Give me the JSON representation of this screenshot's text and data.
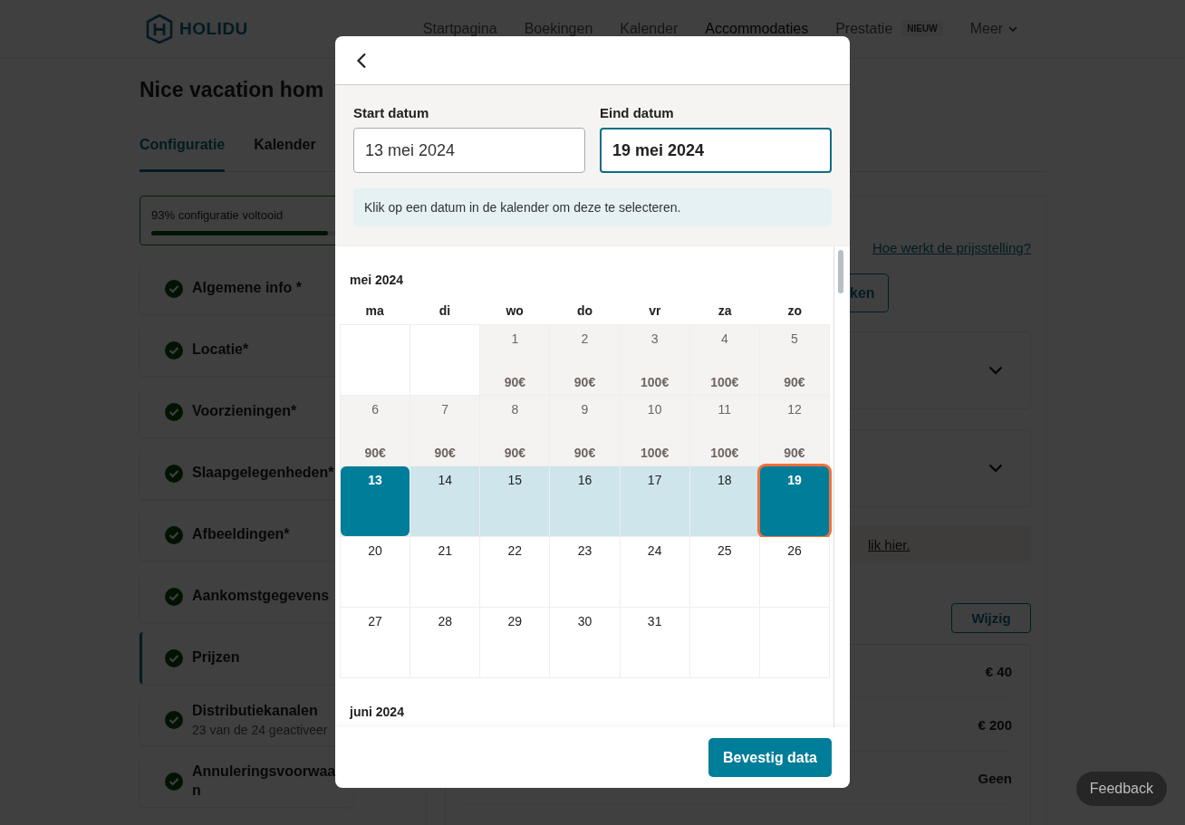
{
  "header": {
    "logo": "HOLIDU",
    "nav": [
      {
        "label": "Startpagina",
        "selected": false
      },
      {
        "label": "Boekingen",
        "selected": false
      },
      {
        "label": "Kalender",
        "selected": false
      },
      {
        "label": "Accommodaties",
        "selected": true
      },
      {
        "label": "Prestatie",
        "selected": false,
        "badge": "NIEUW"
      },
      {
        "label": "Meer",
        "selected": false,
        "dropdown": true
      }
    ]
  },
  "page": {
    "title": "Nice vacation hom",
    "tabs": [
      {
        "label": "Configuratie",
        "selected": true
      },
      {
        "label": "Kalender",
        "selected": false
      }
    ]
  },
  "progress": {
    "label": "93% configuratie voltooid",
    "level": 0.93
  },
  "sidebar": {
    "items": [
      {
        "label": "Algemene info *",
        "done": true,
        "selected": false
      },
      {
        "label": "Locatie*",
        "done": true,
        "selected": false
      },
      {
        "label": "Voorzieningen*",
        "done": true,
        "selected": false
      },
      {
        "label": "Slaapgelegenheden*",
        "done": true,
        "selected": false
      },
      {
        "label": "Afbeeldingen*",
        "done": true,
        "selected": false
      },
      {
        "label": "Aankomstgegevens",
        "done": true,
        "selected": false
      },
      {
        "label": "Prijzen",
        "done": true,
        "selected": true
      },
      {
        "label": "Distributiekanalen",
        "subtitle": "23 van de 24 geactiveer",
        "done": true,
        "selected": false
      },
      {
        "label": "Annuleringsvoorwaa\nn",
        "done": true,
        "selected": false
      }
    ]
  },
  "pricing": {
    "help_link": "Hoe werkt de prijsstelling?",
    "action_button": "ken",
    "panels": [
      {
        "expanded": false
      },
      {
        "expanded": false
      }
    ],
    "notice_link": "lik hier.",
    "edit_button": "Wijzig",
    "fees": [
      "€ 40",
      "€ 200",
      "Geen"
    ]
  },
  "modal": {
    "start": {
      "label": "Start datum",
      "value": "13 mei 2024",
      "focused": false
    },
    "end": {
      "label": "Eind datum",
      "value": "19 mei 2024",
      "focused": true
    },
    "hint": "Klik op een datum in de kalender om deze te selecteren.",
    "months": [
      {
        "title": "mei 2024",
        "weekdays": [
          "ma",
          "di",
          "wo",
          "do",
          "vr",
          "za",
          "zo"
        ],
        "weeks": [
          [
            {
              "kind": "empty"
            },
            {
              "kind": "empty"
            },
            {
              "day": "1",
              "price": "90€",
              "kind": "past"
            },
            {
              "day": "2",
              "price": "90€",
              "kind": "past"
            },
            {
              "day": "3",
              "price": "100€",
              "kind": "past"
            },
            {
              "day": "4",
              "price": "100€",
              "kind": "past"
            },
            {
              "day": "5",
              "price": "90€",
              "kind": "past"
            }
          ],
          [
            {
              "day": "6",
              "price": "90€",
              "kind": "past"
            },
            {
              "day": "7",
              "price": "90€",
              "kind": "past"
            },
            {
              "day": "8",
              "price": "90€",
              "kind": "past"
            },
            {
              "day": "9",
              "price": "90€",
              "kind": "past"
            },
            {
              "day": "10",
              "price": "100€",
              "kind": "past"
            },
            {
              "day": "11",
              "price": "100€",
              "kind": "past"
            },
            {
              "day": "12",
              "price": "90€",
              "kind": "past"
            }
          ],
          [
            {
              "day": "13",
              "kind": "start"
            },
            {
              "day": "14",
              "kind": "range"
            },
            {
              "day": "15",
              "kind": "range"
            },
            {
              "day": "16",
              "kind": "range"
            },
            {
              "day": "17",
              "kind": "range"
            },
            {
              "day": "18",
              "kind": "range"
            },
            {
              "day": "19",
              "kind": "end"
            }
          ],
          [
            {
              "day": "20",
              "kind": "free"
            },
            {
              "day": "21",
              "kind": "free"
            },
            {
              "day": "22",
              "kind": "free"
            },
            {
              "day": "23",
              "kind": "free"
            },
            {
              "day": "24",
              "kind": "free"
            },
            {
              "day": "25",
              "kind": "free"
            },
            {
              "day": "26",
              "kind": "free"
            }
          ],
          [
            {
              "day": "27",
              "kind": "free"
            },
            {
              "day": "28",
              "kind": "free"
            },
            {
              "day": "29",
              "kind": "free"
            },
            {
              "day": "30",
              "kind": "free"
            },
            {
              "day": "31",
              "kind": "free"
            },
            {
              "kind": "empty"
            },
            {
              "kind": "empty"
            }
          ]
        ]
      },
      {
        "title": "juni 2024"
      }
    ],
    "confirm": "Bevestig data"
  },
  "feedback_button": "Feedback"
}
